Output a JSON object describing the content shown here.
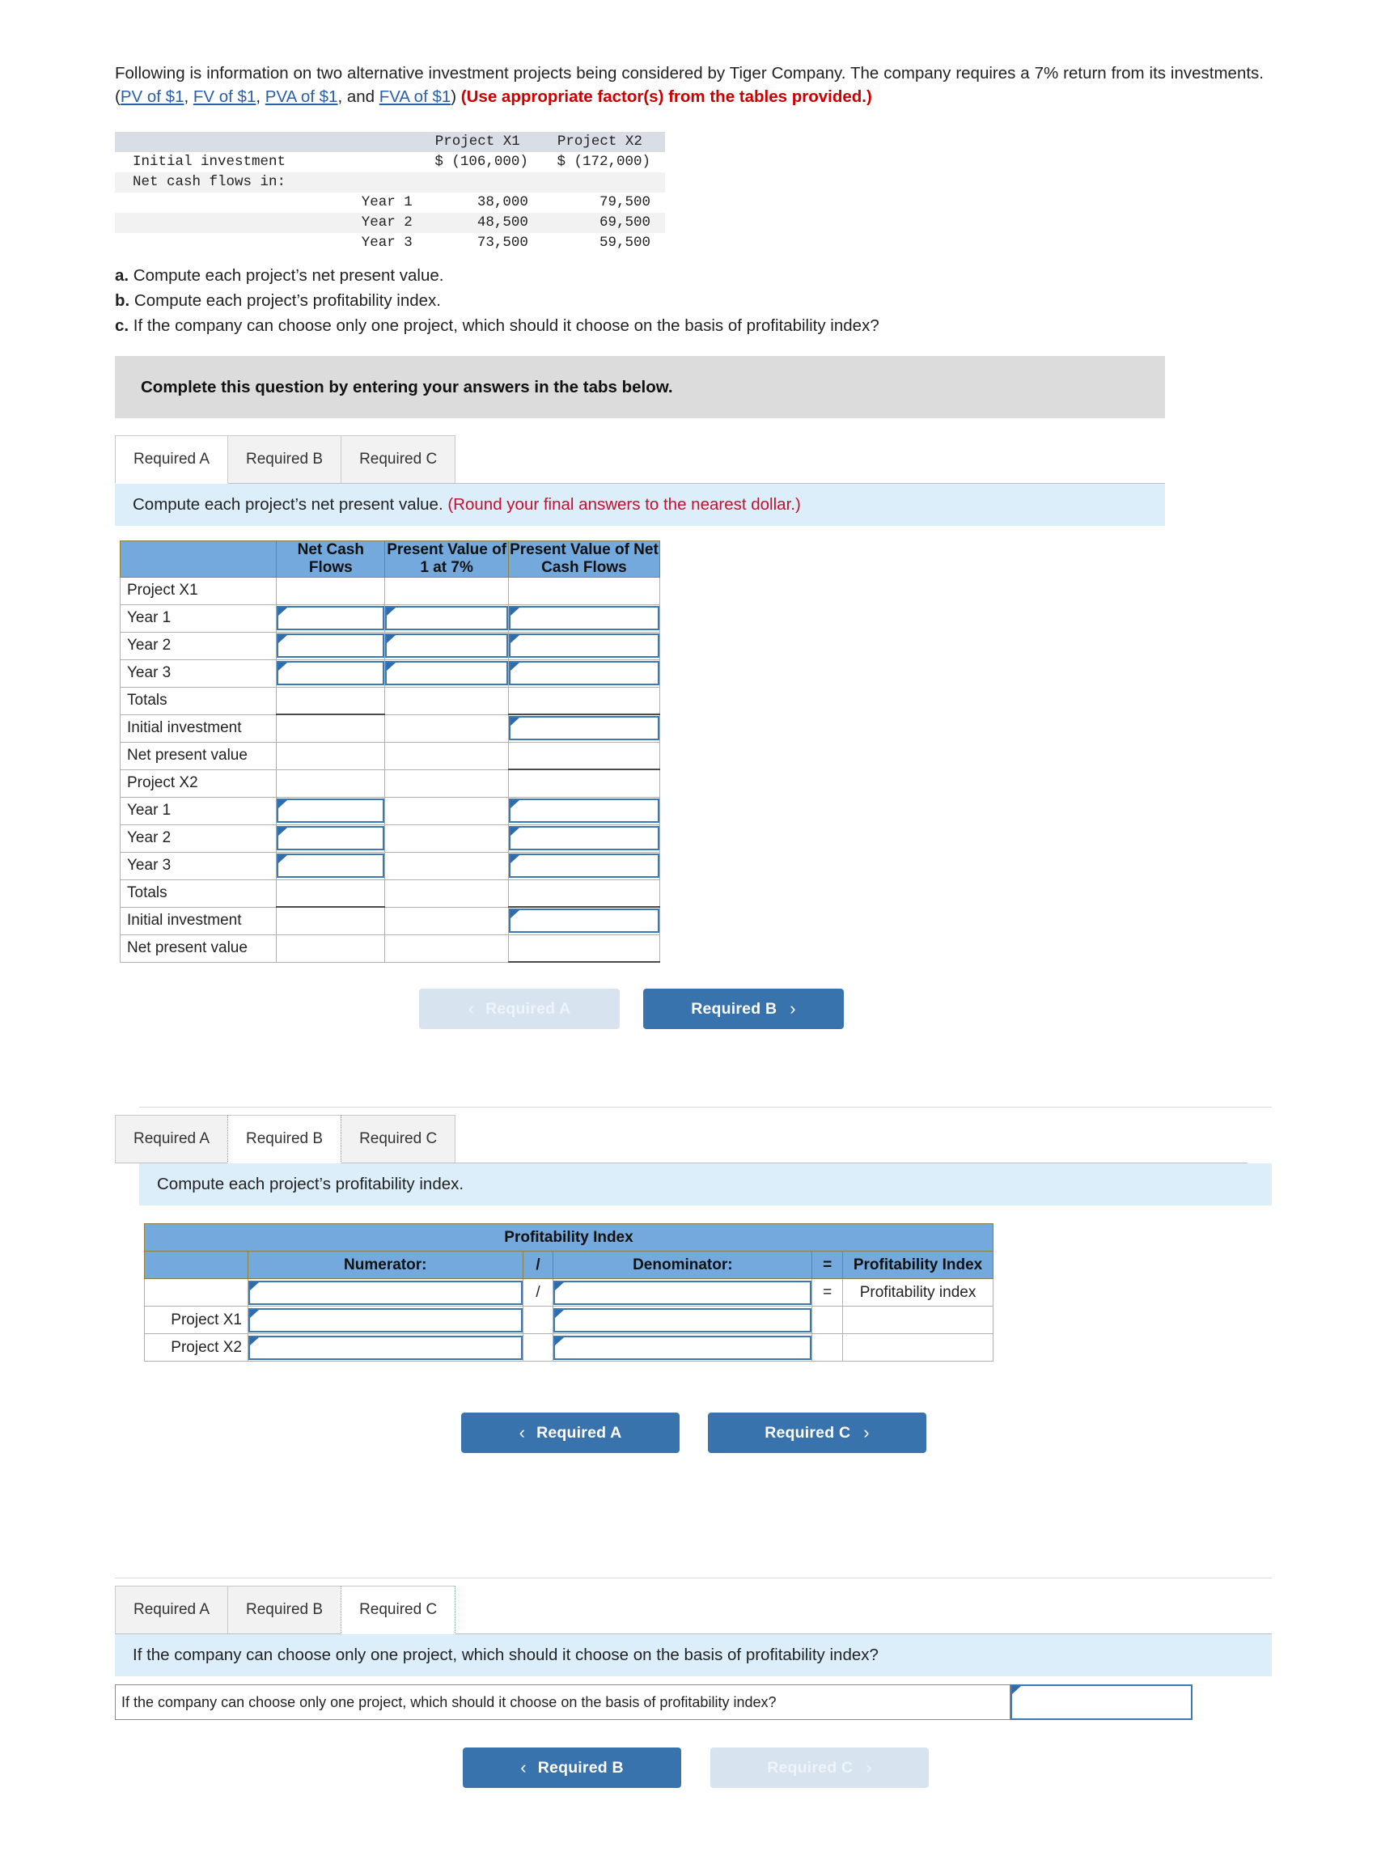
{
  "intro": {
    "text_1": "Following is information on two alternative investment projects being considered by Tiger Company. The company requires a 7% return from its investments. (",
    "link_1": "PV of $1",
    "sep_1": ", ",
    "link_2": "FV of $1",
    "sep_2": ", ",
    "link_3": "PVA of $1",
    "sep_3": ", and ",
    "link_4": "FVA of $1",
    "text_2": ") ",
    "emphasis": "(Use appropriate factor(s) from the tables provided.)"
  },
  "data_table": {
    "col_headers": [
      "",
      "",
      "Project X1",
      "Project X2"
    ],
    "rows": [
      {
        "label": "Initial investment",
        "year": "",
        "x1": "$ (106,000)",
        "x2": "$ (172,000)",
        "shade": "plain"
      },
      {
        "label": "Net cash flows in:",
        "year": "",
        "x1": "",
        "x2": "",
        "shade": "alt"
      },
      {
        "label": "",
        "year": "Year 1",
        "x1": "38,000",
        "x2": "79,500",
        "shade": "plain"
      },
      {
        "label": "",
        "year": "Year 2",
        "x1": "48,500",
        "x2": "69,500",
        "shade": "alt"
      },
      {
        "label": "",
        "year": "Year 3",
        "x1": "73,500",
        "x2": "59,500",
        "shade": "plain"
      }
    ]
  },
  "questions": {
    "a_marker": "a.",
    "a_text": " Compute each project’s net present value.",
    "b_marker": "b.",
    "b_text": " Compute each project’s profitability index.",
    "c_marker": "c.",
    "c_text": " If the company can choose only one project, which should it choose on the basis of profitability index?"
  },
  "grey_banner": {
    "text": "Complete this question by entering your answers in the tabs below."
  },
  "panel_a": {
    "tabs": [
      {
        "label": "Required A",
        "active": true
      },
      {
        "label": "Required B",
        "active": false
      },
      {
        "label": "Required C",
        "active": false
      }
    ],
    "prompt_main": "Compute each project’s net present value. ",
    "prompt_note": "(Round your final answers to the nearest dollar.)",
    "headers": [
      "",
      "Net Cash Flows",
      "Present Value of 1 at 7%",
      "Present Value of Net Cash Flows"
    ],
    "rows": [
      {
        "label": "Project X1",
        "c1": "none",
        "c2": "none",
        "c3": "none"
      },
      {
        "label": "Year 1",
        "c1": "input",
        "c2": "input",
        "c3": "input"
      },
      {
        "label": "Year 2",
        "c1": "input",
        "c2": "input",
        "c3": "input"
      },
      {
        "label": "Year 3",
        "c1": "input",
        "c2": "input",
        "c3": "input"
      },
      {
        "label": "Totals",
        "c1": "total",
        "c2": "none",
        "c3": "total"
      },
      {
        "label": "Initial investment",
        "c1": "none",
        "c2": "none",
        "c3": "input"
      },
      {
        "label": "Net present value",
        "c1": "none",
        "c2": "none",
        "c3": "nptotal"
      },
      {
        "label": "Project X2",
        "c1": "none",
        "c2": "none",
        "c3": "none"
      },
      {
        "label": "Year 1",
        "c1": "input",
        "c2": "none",
        "c3": "input"
      },
      {
        "label": "Year 2",
        "c1": "input",
        "c2": "none",
        "c3": "input"
      },
      {
        "label": "Year 3",
        "c1": "input",
        "c2": "none",
        "c3": "input"
      },
      {
        "label": "Totals",
        "c1": "total",
        "c2": "none",
        "c3": "total"
      },
      {
        "label": "Initial investment",
        "c1": "none",
        "c2": "none",
        "c3": "input"
      },
      {
        "label": "Net present value",
        "c1": "none",
        "c2": "none",
        "c3": "nptotal"
      }
    ],
    "nav_prev": {
      "label": "Required A",
      "state": "disabled",
      "chevron": "‹"
    },
    "nav_next": {
      "label": "Required B",
      "state": "enabled",
      "chevron": "›"
    }
  },
  "panel_b": {
    "tabs": [
      {
        "label": "Required A",
        "active": false
      },
      {
        "label": "Required B",
        "active": true
      },
      {
        "label": "Required C",
        "active": false
      }
    ],
    "prompt_main": "Compute each project’s profitability index.",
    "title_row": "Profitability Index",
    "headers": [
      "",
      "Numerator:",
      "/",
      "Denominator:",
      "=",
      "Profitability Index"
    ],
    "rows": [
      {
        "label": "",
        "num": "input",
        "op1": "/",
        "den": "input",
        "op2": "=",
        "pi": "Profitability index",
        "pi_style": "plain"
      },
      {
        "label": "Project X1",
        "num": "input",
        "op1": "",
        "den": "input",
        "op2": "",
        "pi": "",
        "pi_style": "yellow"
      },
      {
        "label": "Project X2",
        "num": "input",
        "op1": "",
        "den": "input",
        "op2": "",
        "pi": "",
        "pi_style": "yellow"
      }
    ],
    "nav_prev": {
      "label": "Required A",
      "state": "enabled",
      "chevron": "‹"
    },
    "nav_next": {
      "label": "Required C",
      "state": "enabled",
      "chevron": "›"
    }
  },
  "panel_c": {
    "tabs": [
      {
        "label": "Required A",
        "active": false
      },
      {
        "label": "Required B",
        "active": false
      },
      {
        "label": "Required C",
        "active": true
      }
    ],
    "prompt_main": "If the company can choose only one project, which should it choose on the basis of profitability index?",
    "question_label": "If the company can choose only one project, which should it choose on the basis of profitability index?",
    "answer_value": "",
    "nav_prev": {
      "label": "Required B",
      "state": "enabled",
      "chevron": "‹"
    },
    "nav_next": {
      "label": "Required C",
      "state": "disabled",
      "chevron": "›"
    }
  },
  "colors": {
    "header_blue": "#74a9dd",
    "prompt_blue": "#ddeefb",
    "button_blue": "#3973ad",
    "button_disabled": "#d7e3ef",
    "yellow_cell": "#fcfbc9",
    "link_blue": "#2b5faa",
    "red_note": "#c4102e"
  }
}
